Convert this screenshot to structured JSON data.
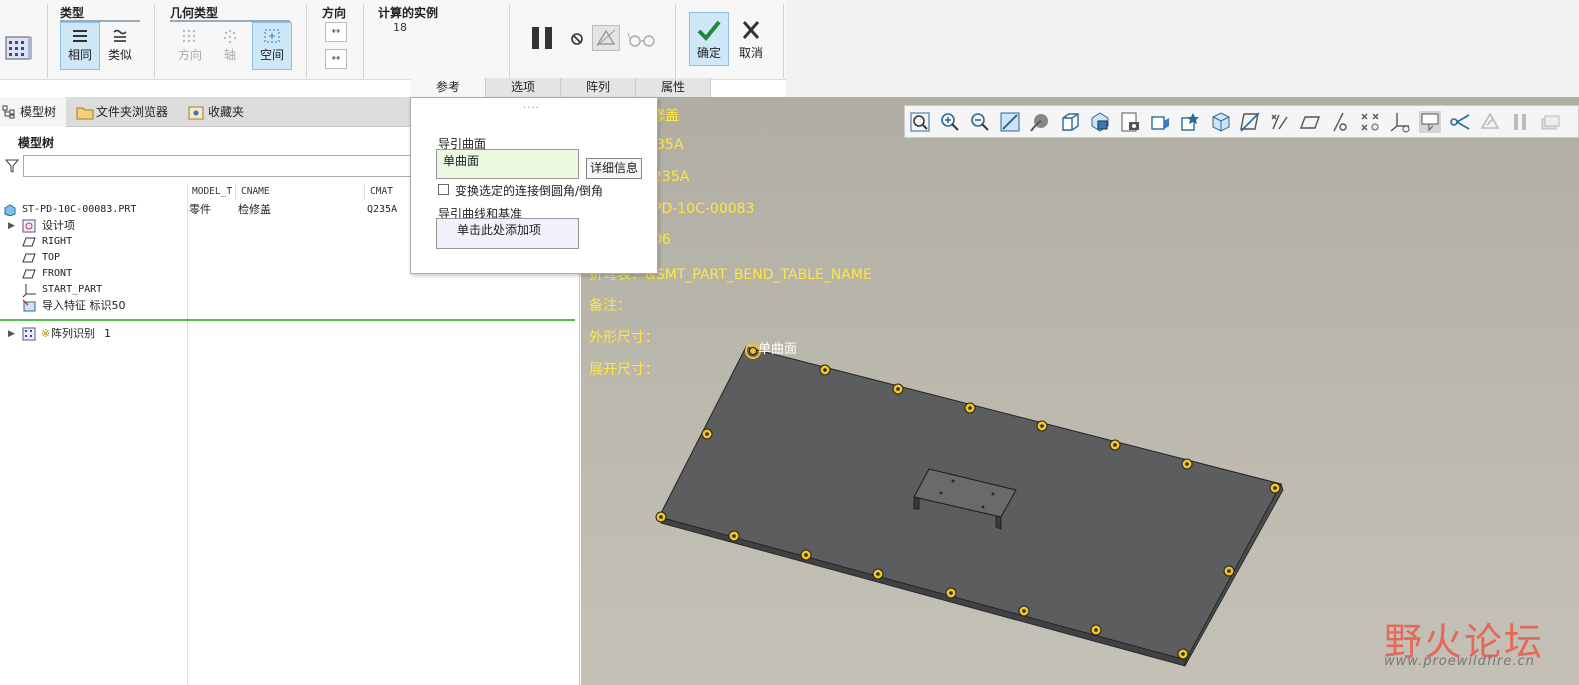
{
  "ribbon": {
    "type_group": {
      "title": "类型",
      "same_label": "相同",
      "similar_label": "类似"
    },
    "geometry_group": {
      "title": "几何类型",
      "direction_label": "方向",
      "axis_label": "轴",
      "space_label": "空间"
    },
    "direction_group": {
      "title": "方向",
      "btn1": "↔",
      "btn2": "↔"
    },
    "instances_group": {
      "title": "计算的实例",
      "value": "18"
    },
    "confirm_label": "确定",
    "cancel_label": "取消",
    "tabs": [
      "参考",
      "选项",
      "阵列",
      "属性"
    ]
  },
  "left_panel": {
    "tabs": [
      "模型树",
      "文件夹浏览器",
      "收藏夹"
    ],
    "title": "模型树",
    "columns": [
      "MODEL_T",
      "CNAME",
      "CMAT"
    ],
    "root": {
      "name": "ST-PD-10C-00083.PRT",
      "model_type": "零件",
      "cname": "检修盖",
      "cmat": "Q235A"
    },
    "items": [
      "设计项",
      "RIGHT",
      "TOP",
      "FRONT",
      "START_PART",
      "导入特征 标识50"
    ],
    "pattern_item": {
      "prefix": "※",
      "name": "阵列识别",
      "number": "1"
    }
  },
  "ref_panel": {
    "grip": "....",
    "guide_surface_label": "导引曲面",
    "guide_surface_value": "单曲面",
    "details_button": "详细信息",
    "replace_checkbox_label": "变换选定的连接倒圆角/倒角",
    "guide_curves_label": "导引曲线和基准",
    "guide_curves_placeholder": "单击此处添加项"
  },
  "viewport": {
    "annotations": [
      "修盖",
      "35A",
      "235A",
      "PD-10C-00083",
      "06",
      "折弯表：&SMT_PART_BEND_TABLE_NAME",
      "备注：",
      "外形尺寸：",
      "展开尺寸："
    ],
    "surface_label": "单曲面",
    "watermark_main": "野火论坛",
    "watermark_sub": "www.proewildfire.cn"
  },
  "colors": {
    "accent": "#cfe8f7",
    "annotation": "#ffe640",
    "plate": "#5b5d5f",
    "hole": "#f3c521",
    "tree_separator": "#4ec04e"
  }
}
